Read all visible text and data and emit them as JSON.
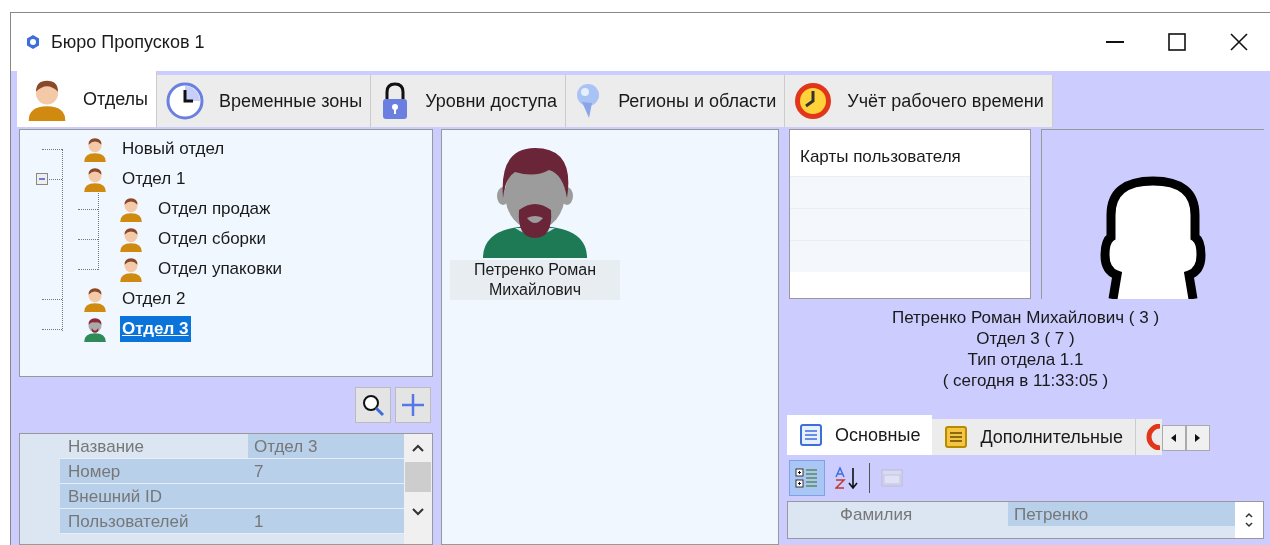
{
  "window": {
    "title": "Бюро Пропусков 1"
  },
  "tabs": [
    {
      "label": "Отделы",
      "selected": true
    },
    {
      "label": "Временные зоны",
      "selected": false
    },
    {
      "label": "Уровни доступа",
      "selected": false
    },
    {
      "label": "Регионы и области",
      "selected": false
    },
    {
      "label": "Учёт рабочего времени",
      "selected": false
    }
  ],
  "tree": [
    {
      "label": "Новый отдел",
      "selected": false
    },
    {
      "label": "Отдел 1",
      "selected": false,
      "expanded": true,
      "children": [
        {
          "label": "Отдел продаж",
          "selected": false
        },
        {
          "label": "Отдел сборки",
          "selected": false
        },
        {
          "label": "Отдел упаковки",
          "selected": false
        }
      ]
    },
    {
      "label": "Отдел 2",
      "selected": false
    },
    {
      "label": "Отдел 3",
      "selected": true
    }
  ],
  "properties": [
    {
      "name": "Название",
      "value": "Отдел 3",
      "selected": true
    },
    {
      "name": "Номер",
      "value": "7",
      "selected": false
    },
    {
      "name": "Внешний ID",
      "selected": false
    },
    {
      "name": "Пользователей",
      "value": "1",
      "selected": false
    }
  ],
  "users": [
    {
      "name": "Петренко Роман Михайлович"
    }
  ],
  "cards": {
    "header": "Карты пользователя"
  },
  "info_lines": [
    "Петренко Роман Михайлович ( 3 )",
    "Отдел 3 ( 7 )",
    "Тип отдела 1.1",
    "( сегодня в 11:33:05 )"
  ],
  "detail_tabs": [
    {
      "label": "Основные",
      "selected": true
    },
    {
      "label": "Дополнительные",
      "selected": false
    },
    {
      "selected": false
    }
  ],
  "detail_toolbar": [
    {
      "kind": "categorized",
      "selected": true,
      "disabled": false
    },
    {
      "kind": "alphabetical",
      "selected": false,
      "disabled": false
    },
    {
      "kind": "pages",
      "selected": false,
      "disabled": true
    }
  ],
  "detail_properties": [
    {
      "name": "Фамилия",
      "value": "Петренко"
    }
  ]
}
